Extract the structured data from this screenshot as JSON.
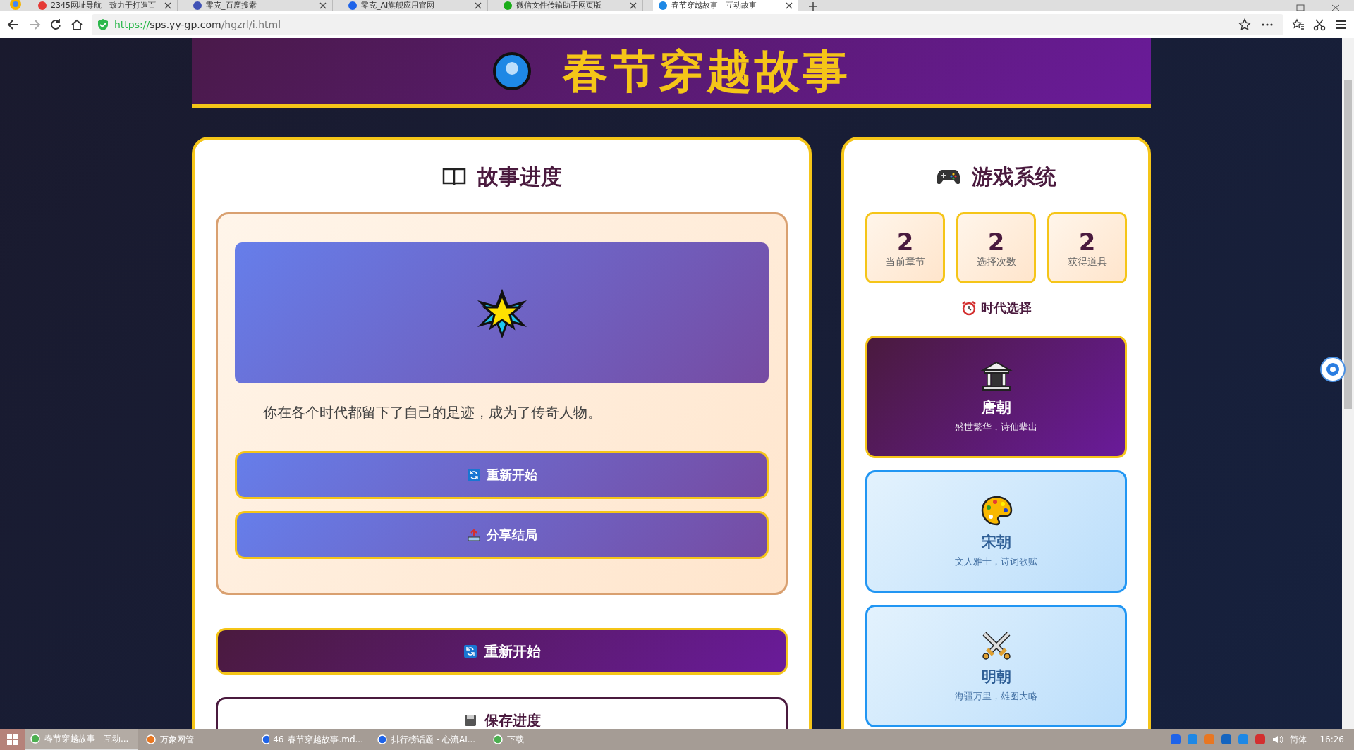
{
  "browser": {
    "tabs": [
      {
        "title": "2345网址导航 - 致力于打造百",
        "selected": false
      },
      {
        "title": "零克_百度搜索",
        "selected": false
      },
      {
        "title": "零克_AI旗舰应用官网",
        "selected": false
      },
      {
        "title": "微信文件传输助手网页版",
        "selected": false
      },
      {
        "title": "春节穿越故事 - 互动故事",
        "selected": true
      }
    ],
    "address": {
      "scheme": "https://",
      "host": "sps.yy-gp.com",
      "path": "/hgzrl/i.html"
    }
  },
  "header": {
    "title": "春节穿越故事"
  },
  "story": {
    "heading": "故事进度",
    "text": "你在各个时代都留下了自己的足迹，成为了传奇人物。",
    "inner_buttons": [
      "重新开始",
      "分享结局"
    ],
    "buttons": [
      "重新开始",
      "保存进度"
    ]
  },
  "game": {
    "heading": "游戏系统",
    "stats": [
      {
        "value": "2",
        "label": "当前章节"
      },
      {
        "value": "2",
        "label": "选择次数"
      },
      {
        "value": "2",
        "label": "获得道具"
      }
    ],
    "era_heading": "时代选择",
    "eras": [
      {
        "name": "唐朝",
        "description": "盛世繁华，诗仙辈出",
        "selected": true
      },
      {
        "name": "宋朝",
        "description": "文人雅士，诗词歌赋",
        "selected": false
      },
      {
        "name": "明朝",
        "description": "海疆万里，雄图大略",
        "selected": false
      }
    ]
  },
  "taskbar": {
    "items": [
      {
        "label": "春节穿越故事 - 互动...",
        "selected": true
      },
      {
        "label": "万象网管",
        "selected": false
      },
      {
        "label": "46_春节穿越故事.md...",
        "selected": false
      },
      {
        "label": "排行榜话题 - 心流AI...",
        "selected": false
      },
      {
        "label": "下载",
        "selected": false
      }
    ],
    "language": "简体",
    "time": "16:26"
  }
}
